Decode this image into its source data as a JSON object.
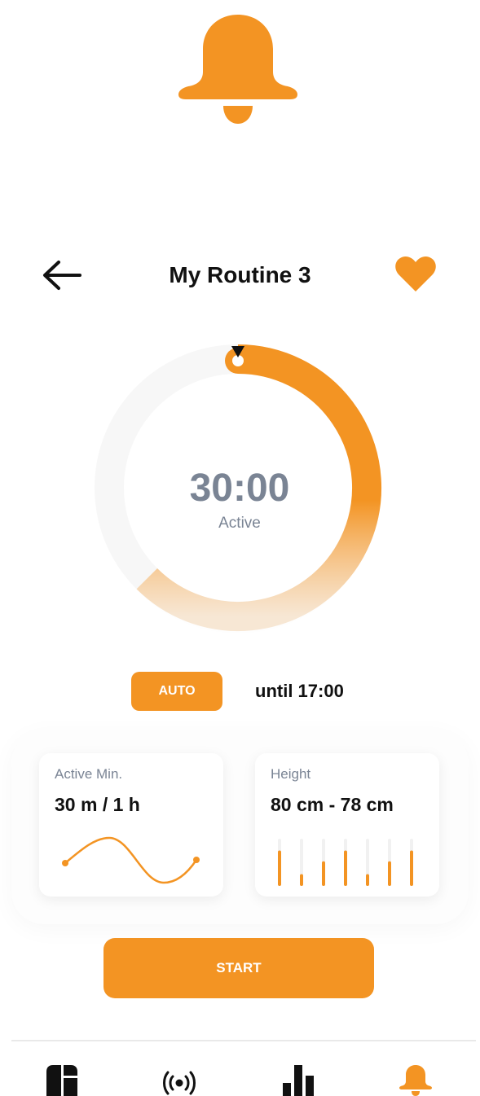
{
  "colors": {
    "accent": "#f39423",
    "muted": "#7a8494",
    "track": "#f7f7f7"
  },
  "top_icon": {
    "icon": "bell-icon"
  },
  "header": {
    "back_icon": "arrow-left-icon",
    "title": "My Routine 3",
    "favorite_icon": "heart-icon"
  },
  "timer": {
    "time": "30:00",
    "status": "Active",
    "progress": 0.625
  },
  "schedule": {
    "mode_label": "AUTO",
    "until_text": "until 17:00"
  },
  "cards": [
    {
      "label": "Active Min.",
      "value": "30 m / 1 h",
      "graphic": "wave"
    },
    {
      "label": "Height",
      "value": "80 cm - 78 cm",
      "graphic": "bars",
      "bar_levels": [
        0.75,
        0.25,
        0.52,
        0.75,
        0.25,
        0.52,
        0.75
      ]
    }
  ],
  "start_label": "START",
  "bottom_nav": [
    {
      "icon": "dashboard-icon"
    },
    {
      "icon": "broadcast-icon"
    },
    {
      "icon": "bar-chart-icon"
    },
    {
      "icon": "bell-icon",
      "active": true
    }
  ]
}
